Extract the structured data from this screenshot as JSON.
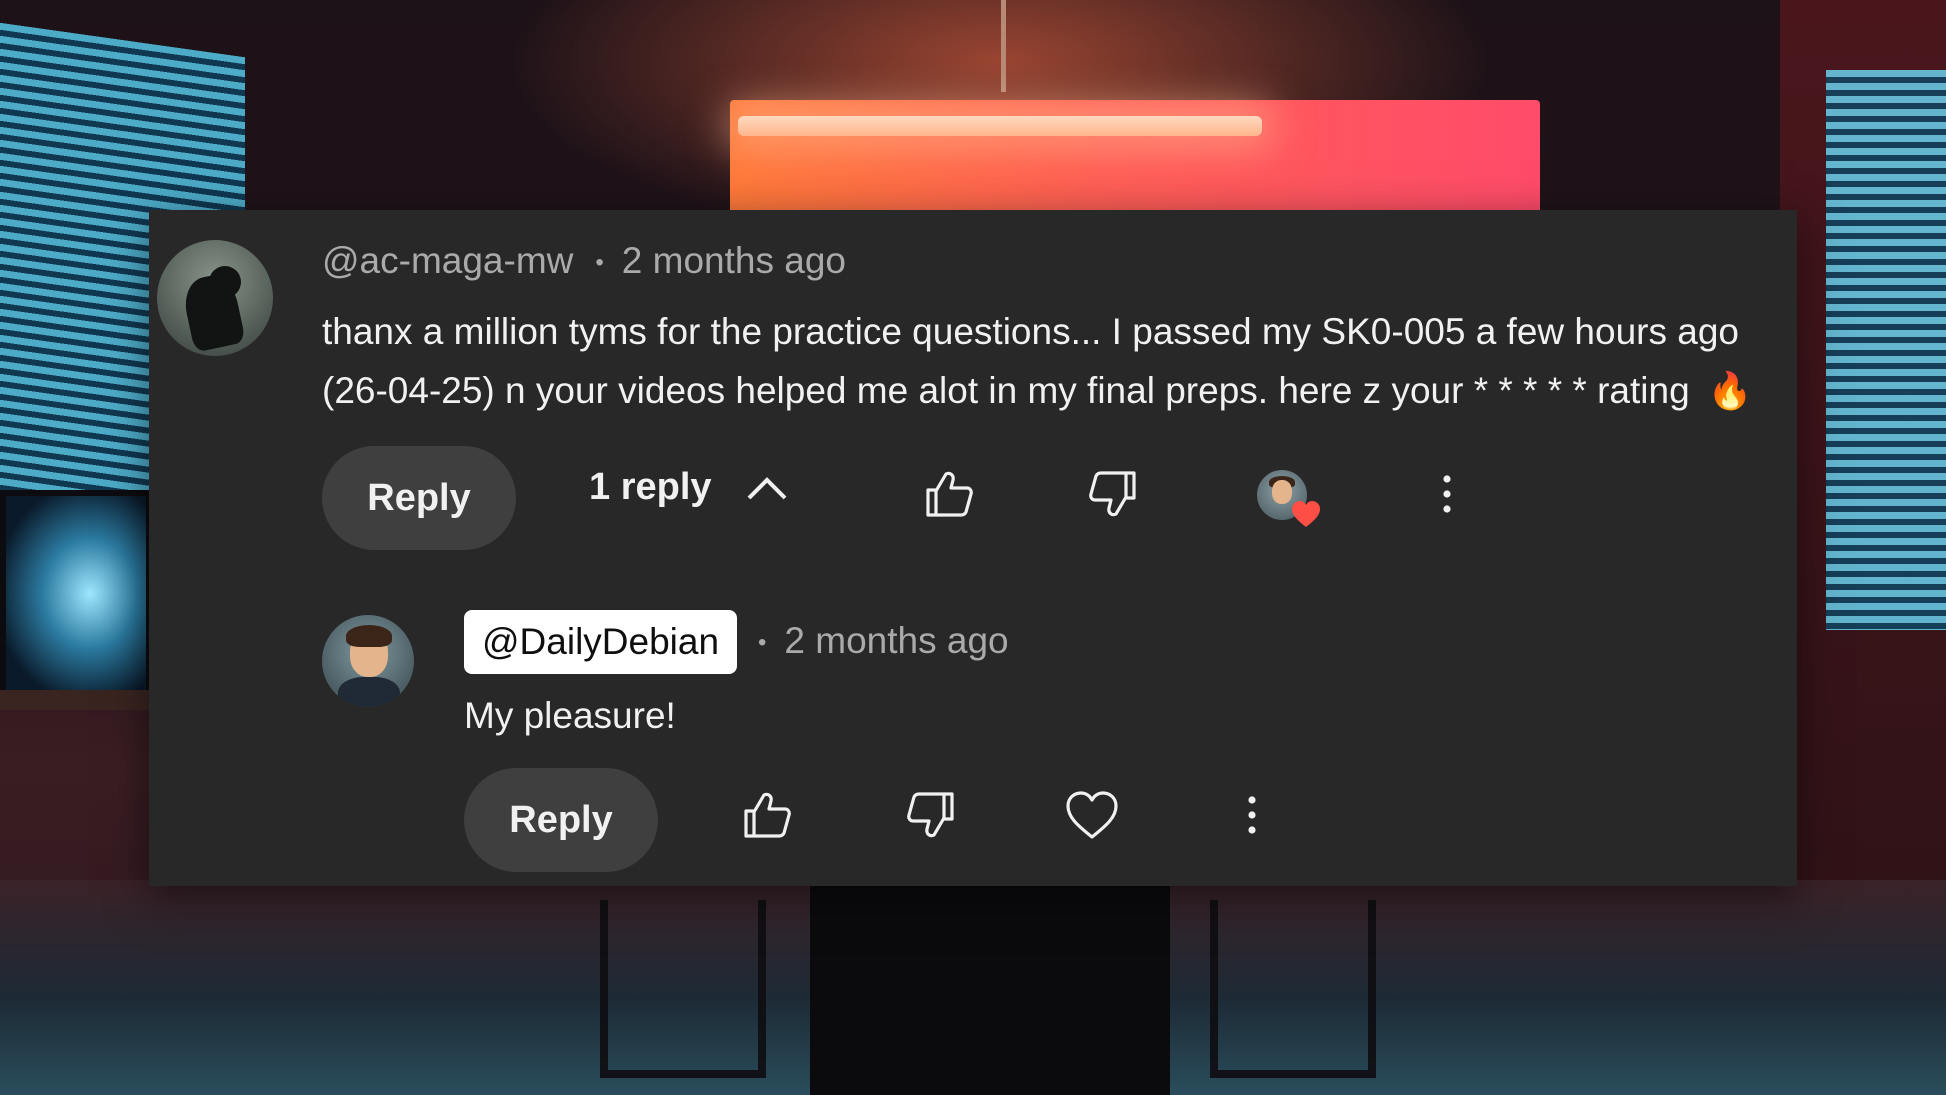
{
  "comment": {
    "author": "@ac-maga-mw",
    "separator": "•",
    "time": "2 months ago",
    "text_line1": "thanx a million tyms for the practice questions... I passed my SK0-005 a few hours ago",
    "text_line2": "(26-04-25) n your  videos helped me alot in my final preps. here z your * * * * * rating",
    "emoji": "🔥",
    "reply_button_label": "Reply",
    "replies_toggle_label": "1 reply",
    "hearted": true
  },
  "reply": {
    "author": "@DailyDebian",
    "separator": "•",
    "time": "2 months ago",
    "text": "My pleasure!",
    "reply_button_label": "Reply"
  },
  "icons": {
    "like": "thumbs-up-icon",
    "dislike": "thumbs-down-icon",
    "more": "more-vertical-icon",
    "collapse": "chevron-up-icon",
    "heart": "heart-icon"
  },
  "colors": {
    "card_background": "#282828",
    "button_background": "#3f3f3f",
    "text_primary": "#f1f1f1",
    "text_secondary": "#aaaaaa",
    "heart_red": "#ff4e45"
  }
}
